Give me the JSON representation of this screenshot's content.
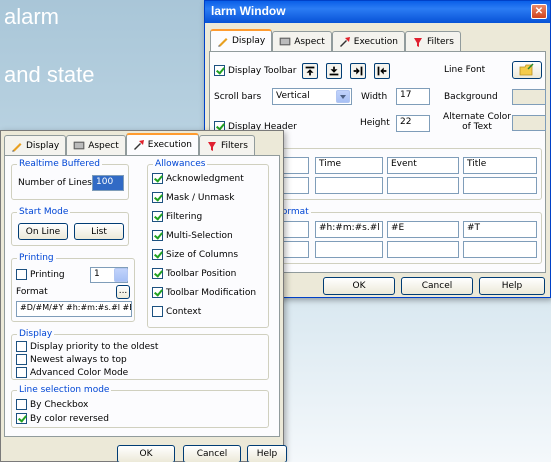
{
  "background_text": [
    "alarm",
    "and state"
  ],
  "alarm_window": {
    "title": "larm Window",
    "tabs": [
      {
        "label": "Display",
        "icon": "pencil-icon"
      },
      {
        "label": "Aspect",
        "icon": "monitor-icon"
      },
      {
        "label": "Execution",
        "icon": "run-icon"
      },
      {
        "label": "Filters",
        "icon": "filter-icon"
      }
    ],
    "display_toolbar_label": "Display Toolbar",
    "line_font_label": "Line Font",
    "scroll_bars_label": "Scroll bars",
    "scroll_bars_value": "Vertical",
    "width_label": "Width",
    "width_value": "17",
    "background_label": "Background",
    "display_header_label": "Display  Header",
    "height_label": "Height",
    "height_value": "22",
    "alternate_color_label_1": "Alternate Color",
    "alternate_color_label_2": "of Text",
    "header_cells": [
      "",
      "Time",
      "Event",
      "Title"
    ],
    "format_label": "Format",
    "format_cells": [
      "",
      "#h:#m:#s.#l",
      "#E",
      "#T"
    ],
    "ok_label": "OK",
    "cancel_label": "Cancel",
    "help_label": "Help"
  },
  "exec_window": {
    "tabs": [
      {
        "label": "Display",
        "icon": "pencil-icon"
      },
      {
        "label": "Aspect",
        "icon": "monitor-icon"
      },
      {
        "label": "Execution",
        "icon": "run-icon"
      },
      {
        "label": "Filters",
        "icon": "filter-icon"
      }
    ],
    "realtime_title": "Realtime Buffered",
    "number_of_lines_label": "Number of Lines",
    "number_of_lines_value": "100",
    "start_mode_title": "Start Mode",
    "online_label": "On Line",
    "list_label": "List",
    "printing_title": "Printing",
    "printing_label": "Printing",
    "printing_value": "1",
    "format_label": "Format",
    "format_value": "#D/#M/#Y #h:#m:#s.#l #E #",
    "browse_label": "...",
    "display_title": "Display",
    "display_options": [
      {
        "label": "Display priority to the oldest",
        "checked": false
      },
      {
        "label": "Newest always to top",
        "checked": false
      },
      {
        "label": "Advanced Color Mode",
        "checked": false
      }
    ],
    "line_selection_title": "Line selection mode",
    "line_selection_options": [
      {
        "label": "By Checkbox",
        "checked": false
      },
      {
        "label": "By color reversed",
        "checked": true
      }
    ],
    "allowances_title": "Allowances",
    "allowances": [
      {
        "label": "Acknowledgment",
        "checked": true
      },
      {
        "label": "Mask / Unmask",
        "checked": true
      },
      {
        "label": "Filtering",
        "checked": true
      },
      {
        "label": "Multi-Selection",
        "checked": true
      },
      {
        "label": "Size of Columns",
        "checked": true
      },
      {
        "label": "Toolbar Position",
        "checked": true
      },
      {
        "label": "Toolbar Modification",
        "checked": true
      },
      {
        "label": "Context",
        "checked": false
      }
    ],
    "ok_label": "OK",
    "cancel_label": "Cancel",
    "help_label": "Help"
  },
  "colors": {
    "titlebar": "#0a5fe8",
    "group_title": "#0046d5",
    "dialog_bg": "#ece9d8",
    "active_tab_accent": "#ff9b2f"
  }
}
